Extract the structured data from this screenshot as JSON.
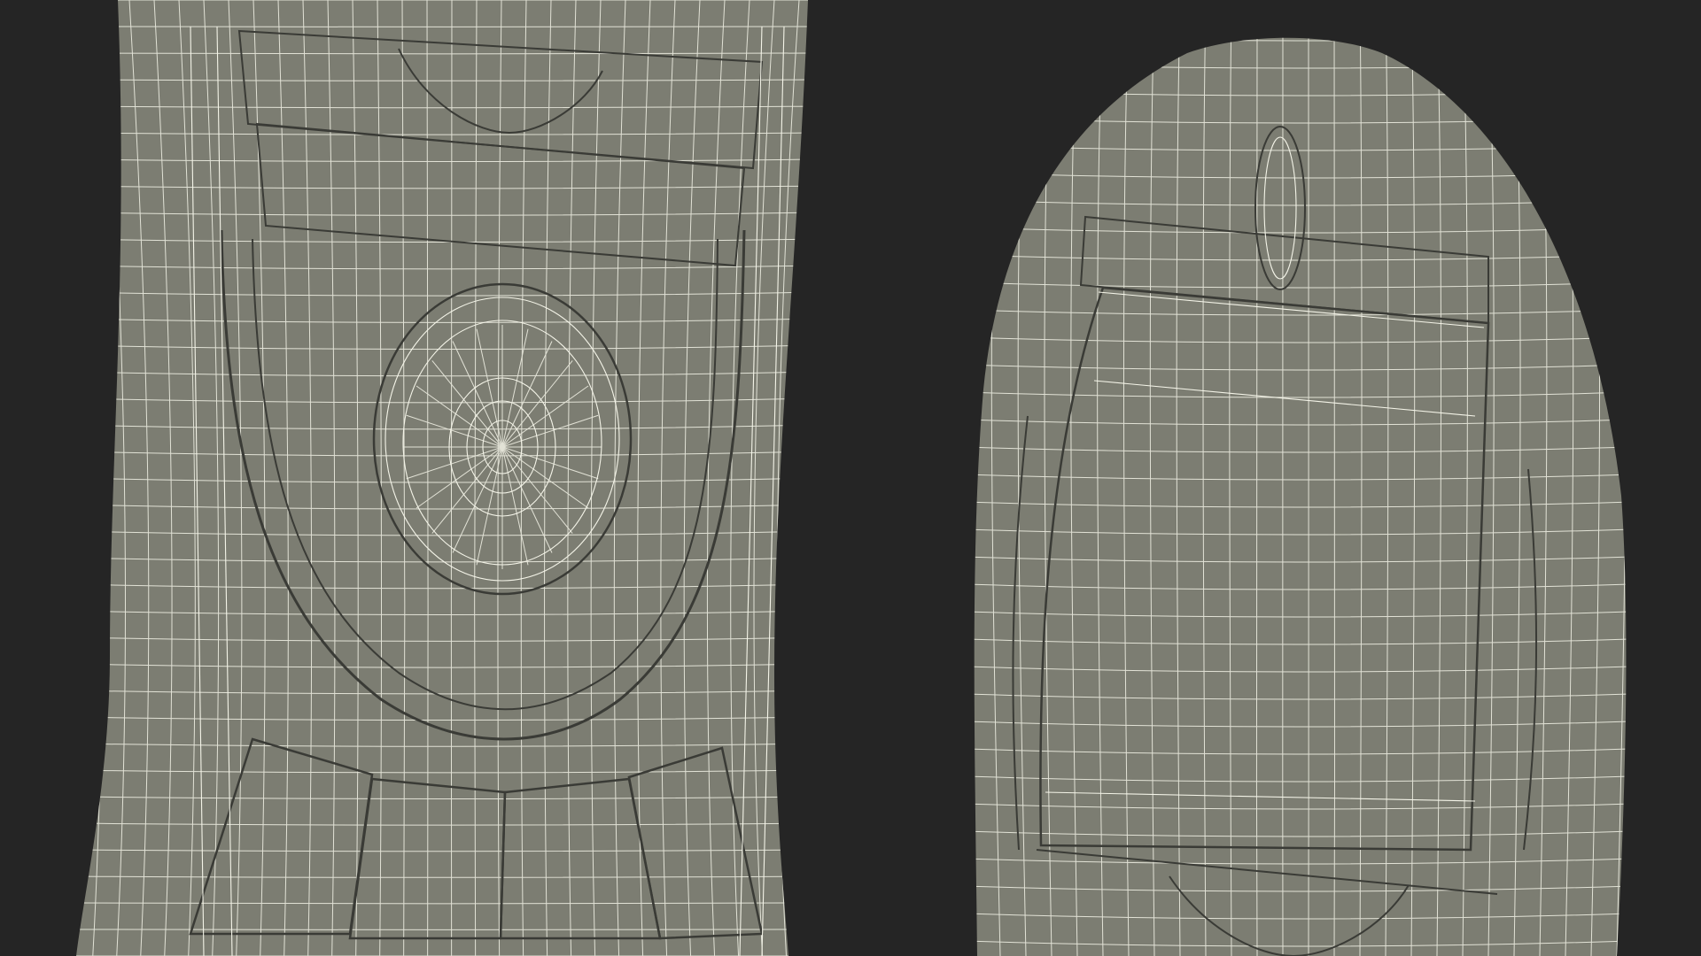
{
  "scene": {
    "description_hidden": "",
    "background_color": "#252525",
    "mesh_fill_color": "#7c7d72",
    "mesh_shadow_color": "#6a6b61",
    "wire_color": "#f4f4e8",
    "edge_color": "#3a3b36",
    "objects": [
      {
        "icon": "remote-control-front-wireframe-icon"
      },
      {
        "icon": "remote-control-back-wireframe-icon"
      }
    ]
  }
}
